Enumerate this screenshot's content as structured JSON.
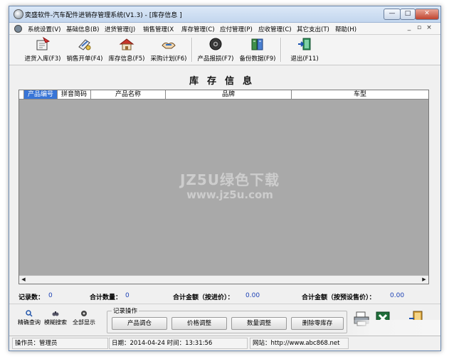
{
  "titlebar": {
    "title": "奕盛软件-汽车配件进销存管理系统(V1.3) - [库存信息 ]",
    "minimize": "—",
    "maximize": "□",
    "close": "✕"
  },
  "menubar": {
    "items": [
      "系统设置(V)",
      "基础信息(B)",
      "进货管理(J)",
      "销售管理(X",
      "库存管理(C)",
      "应付管理(P)",
      "应收管理(C)",
      "其它支出(T)",
      "帮助(H)"
    ],
    "mdi_min": "_",
    "mdi_restore": "▫",
    "mdi_close": "×"
  },
  "toolbar": {
    "items": [
      {
        "label": "进货入库(F3)",
        "icon": "stock-in-icon"
      },
      {
        "label": "销售开单(F4)",
        "icon": "sales-order-icon"
      },
      {
        "label": "库存信息(F5)",
        "icon": "inventory-icon"
      },
      {
        "label": "采购计划(F6)",
        "icon": "purchase-plan-icon"
      },
      {
        "label": "产品报损(F7)",
        "icon": "product-loss-icon"
      },
      {
        "label": "备份数据(F9)",
        "icon": "backup-icon"
      },
      {
        "label": "退出(F11)",
        "icon": "exit-icon"
      }
    ]
  },
  "page": {
    "title": "库存信息"
  },
  "grid": {
    "columns": [
      "产品编号",
      "拼音简码",
      "产品名称",
      "品牌",
      "车型"
    ],
    "selected_column": "产品编号",
    "rows": []
  },
  "watermark": {
    "line1": "JZ5U绿色下载",
    "line2": "www.jz5u.com"
  },
  "totals": {
    "record_count_label": "记录数：",
    "record_count": "0",
    "total_qty_label": "合计数量：",
    "total_qty": "0",
    "amount_cost_label": "合计金额（按进价）：",
    "amount_cost": "0.00",
    "amount_price_label": "合计金额（按预设售价）：",
    "amount_price": "0.00"
  },
  "bottom": {
    "exact_search": "精确查询",
    "fuzzy_search": "模糊搜索",
    "show_all": "全部显示",
    "group_label": "记录操作",
    "buttons": [
      "产品调仓",
      "价格调整",
      "数量调整",
      "删除零库存"
    ]
  },
  "status": {
    "operator": "操作员：管理员",
    "datetime": "日期：2014-04-24 时间：13:31:56",
    "website": "网站：http://www.abc868.net"
  },
  "colors": {
    "accent": "#3875d7",
    "grid_bg": "#a9a9a9",
    "value_text": "#1a3fb4"
  }
}
